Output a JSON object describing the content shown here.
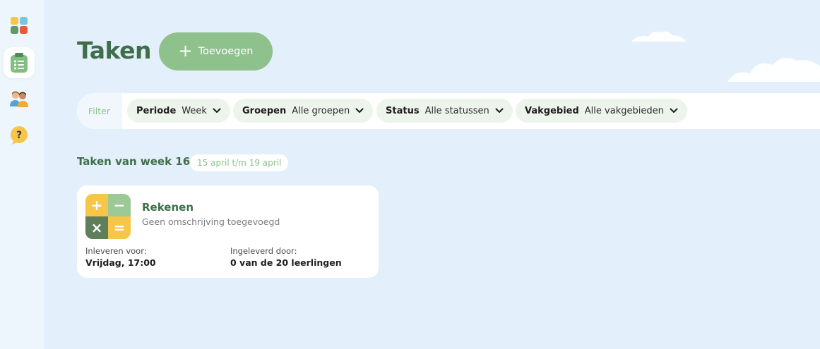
{
  "sidebar": {
    "items": [
      {
        "icon": "apps-grid-icon",
        "active": false
      },
      {
        "icon": "clipboard-tasks-icon",
        "active": true
      },
      {
        "icon": "students-icon",
        "active": false
      },
      {
        "icon": "help-icon",
        "glyph": "?",
        "active": false
      }
    ]
  },
  "header": {
    "title": "Taken",
    "add_button": {
      "icon": "+",
      "label": "Toevoegen"
    }
  },
  "filter": {
    "label": "Filter",
    "pills": [
      {
        "name": "Periode",
        "value": "Week"
      },
      {
        "name": "Groepen",
        "value": "Alle groepen"
      },
      {
        "name": "Status",
        "value": "Alle statussen"
      },
      {
        "name": "Vakgebied",
        "value": "Alle vakgebieden"
      }
    ]
  },
  "week_section": {
    "title": "Taken van week 16",
    "range": "15 april t/m 19 april"
  },
  "tasks": [
    {
      "name": "Rekenen",
      "description": "Geen omschrijving toegevoegd",
      "icon_symbols": [
        "+",
        "−",
        "×",
        "="
      ],
      "due_label": "Inleveren voor:",
      "due_value": "Vrijdag, 17:00",
      "submitted_label": "Ingeleverd door:",
      "submitted_value": "0 van de 20 leerlingen"
    }
  ],
  "colors": {
    "brand_green": "#3f6e48",
    "button_green": "#8fc18d",
    "background": "#e3f0fb",
    "icon_yellow": "#f7c548",
    "icon_light_green": "#9cc996",
    "icon_dark_green": "#5e7f5a"
  }
}
